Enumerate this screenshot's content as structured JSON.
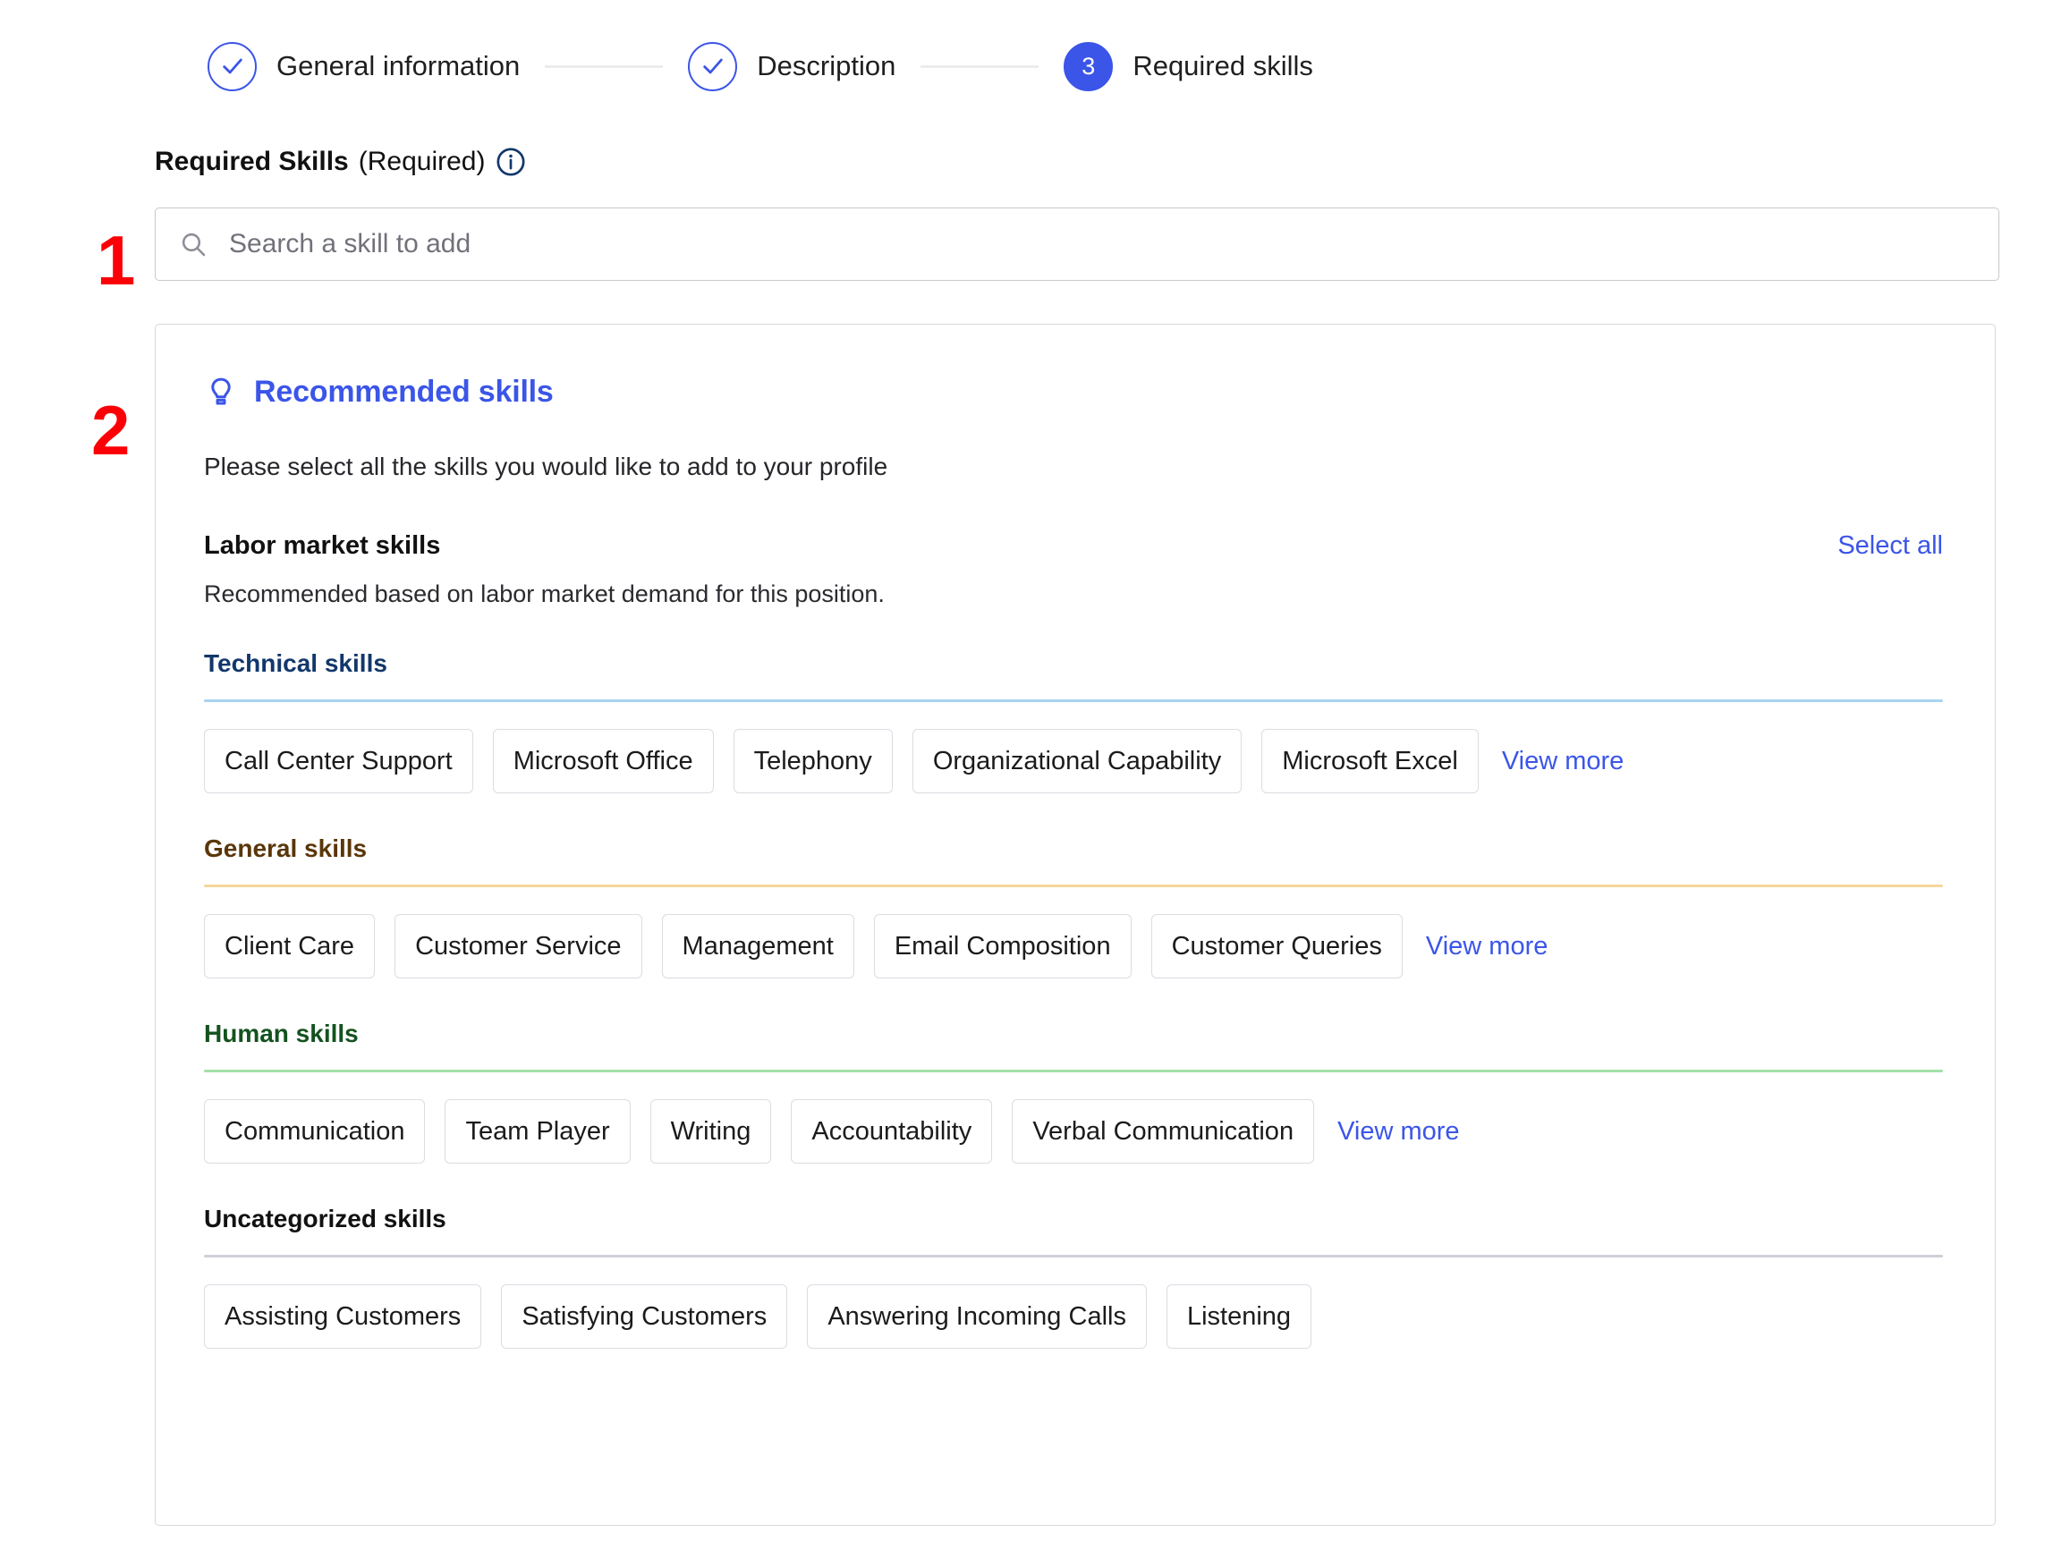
{
  "stepper": {
    "steps": [
      {
        "label": "General information",
        "state": "done",
        "num": ""
      },
      {
        "label": "Description",
        "state": "done",
        "num": ""
      },
      {
        "label": "Required skills",
        "state": "current",
        "num": "3"
      }
    ]
  },
  "field": {
    "label_strong": "Required Skills",
    "label_normal": "(Required)",
    "info_icon": "info-circle-icon"
  },
  "annotations": {
    "one": "1",
    "two": "2"
  },
  "search": {
    "placeholder": "Search a skill to add",
    "value": "",
    "icon": "search-icon"
  },
  "recommended": {
    "icon": "lightbulb-icon",
    "title": "Recommended skills",
    "subtitle": "Please select all the skills you would like to add to your profile",
    "group": {
      "title": "Labor market skills",
      "select_all": "Select all",
      "description": "Recommended based on labor market demand for this position."
    },
    "categories": [
      {
        "key": "technical",
        "title": "Technical skills",
        "title_color": "#12376b",
        "rule_color": "#a9d3f2",
        "chips": [
          "Call Center Support",
          "Microsoft Office",
          "Telephony",
          "Organizational Capability",
          "Microsoft Excel"
        ],
        "view_more": "View more"
      },
      {
        "key": "general",
        "title": "General skills",
        "title_color": "#5a3609",
        "rule_color": "#f5d79a",
        "chips": [
          "Client Care",
          "Customer Service",
          "Management",
          "Email Composition",
          "Customer Queries"
        ],
        "view_more": "View more"
      },
      {
        "key": "human",
        "title": "Human skills",
        "title_color": "#14521f",
        "rule_color": "#a3e0a8",
        "chips": [
          "Communication",
          "Team Player",
          "Writing",
          "Accountability",
          "Verbal Communication"
        ],
        "view_more": "View more"
      },
      {
        "key": "uncategorized",
        "title": "Uncategorized skills",
        "title_color": "#111111",
        "rule_color": "#cfcfd8",
        "chips": [
          "Assisting Customers",
          "Satisfying Customers",
          "Answering Incoming Calls",
          "Listening"
        ],
        "view_more": ""
      }
    ]
  },
  "colors": {
    "accent_blue": "#3b55e8",
    "annotation_red": "#fb0007",
    "info_navy": "#12376b"
  }
}
